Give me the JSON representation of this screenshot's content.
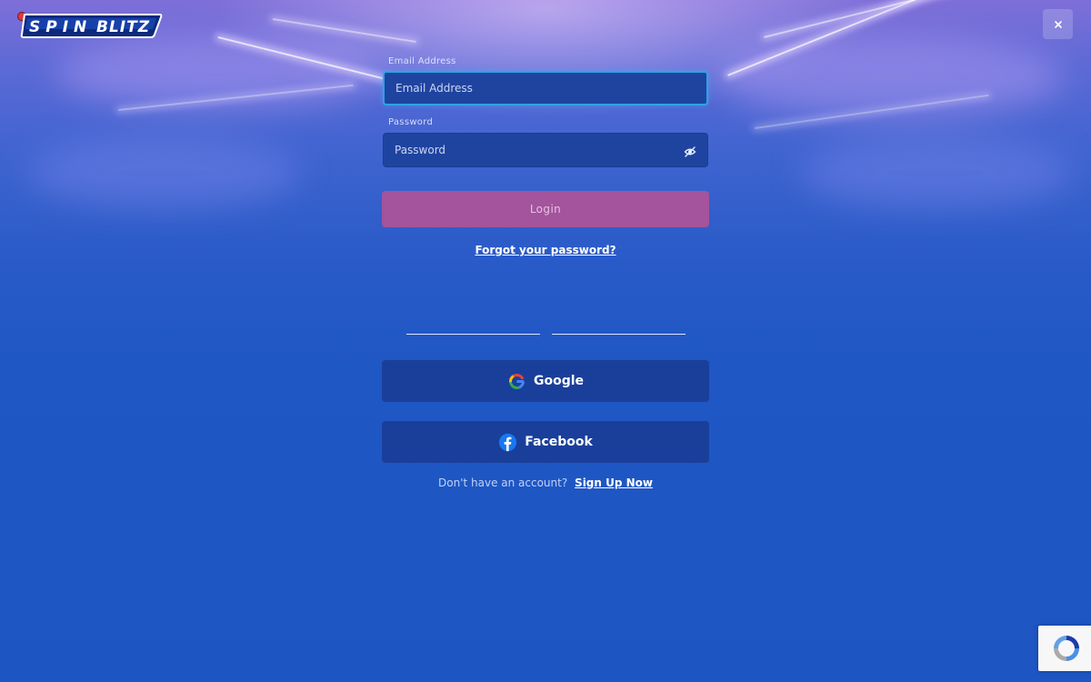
{
  "brand": {
    "name": "SPIN BLITZ"
  },
  "close_button": {
    "label": "×"
  },
  "email": {
    "label": "Email Address",
    "placeholder": "Email Address",
    "value": ""
  },
  "password": {
    "label": "Password",
    "placeholder": "Password",
    "value": ""
  },
  "login_button": {
    "label": "Login"
  },
  "forgot_password": {
    "label": "Forgot your password?"
  },
  "social": {
    "google": {
      "label": "Google",
      "icon": "google-icon"
    },
    "facebook": {
      "label": "Facebook",
      "icon": "facebook-icon"
    }
  },
  "signup": {
    "prompt": "Don't have an account?",
    "link": "Sign Up Now"
  },
  "colors": {
    "background": "#1f58c4",
    "input_bg": "#1f44a0",
    "focus_ring": "#2ea2e6",
    "login_button": "#a3549c",
    "social_button": "#1a3f9a"
  }
}
